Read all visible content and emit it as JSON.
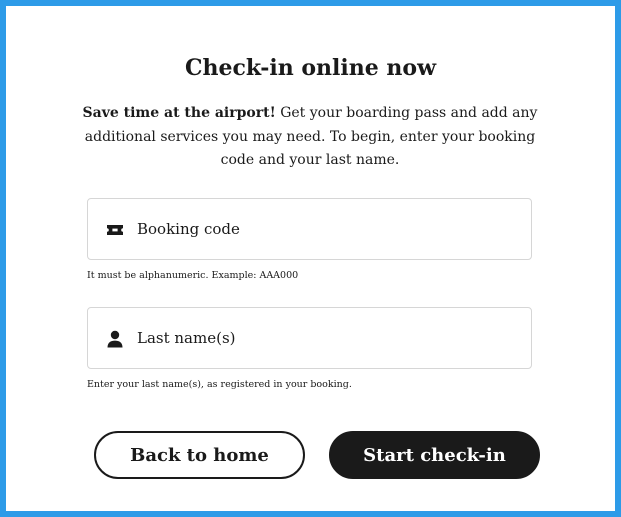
{
  "title": "Check-in online now",
  "intro": {
    "bold": "Save time at the airport!",
    "text": " Get your boarding pass and add any additional services you may need. To begin, enter your booking code and your last name."
  },
  "booking_field": {
    "icon": "ticket-icon",
    "placeholder": "Booking code",
    "value": "",
    "hint": "It must be alphanumeric. Example: AAA000"
  },
  "lastname_field": {
    "icon": "person-icon",
    "placeholder": "Last name(s)",
    "value": "",
    "hint": "Enter your last name(s), as registered in your booking."
  },
  "buttons": {
    "back_label": "Back to home",
    "start_label": "Start check-in"
  },
  "colors": {
    "frame": "#2d9be8",
    "primary": "#1a1a1a",
    "background": "#ffffff",
    "border": "#d6d6d6"
  }
}
